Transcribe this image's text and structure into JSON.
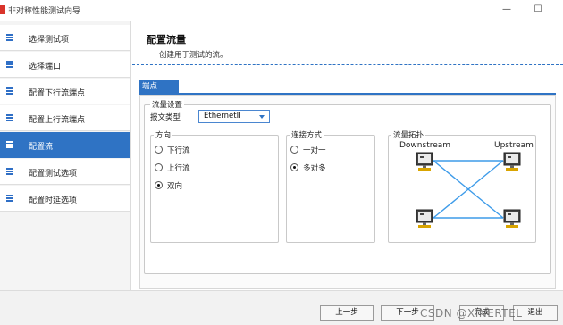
{
  "window": {
    "title": "非对称性能测试向导",
    "minimize_glyph": "—",
    "maximize_glyph": "☐"
  },
  "sidebar": {
    "items": [
      {
        "label": "选择测试项",
        "active": false
      },
      {
        "label": "选择端口",
        "active": false
      },
      {
        "label": "配置下行流端点",
        "active": false
      },
      {
        "label": "配置上行流端点",
        "active": false
      },
      {
        "label": "配置流",
        "active": true
      },
      {
        "label": "配置测试选项",
        "active": false
      },
      {
        "label": "配置时延选项",
        "active": false
      }
    ]
  },
  "main": {
    "title": "配置流量",
    "subtitle": "创建用于测试的流。",
    "tab_label": "端点",
    "flow_settings": {
      "legend": "流量设置",
      "frame_type_label": "报文类型",
      "frame_type_value": "EthernetII"
    },
    "direction": {
      "legend": "方向",
      "options": [
        {
          "label": "下行流",
          "checked": false
        },
        {
          "label": "上行流",
          "checked": false
        },
        {
          "label": "双向",
          "checked": true
        }
      ]
    },
    "connection": {
      "legend": "连接方式",
      "options": [
        {
          "label": "一对一",
          "checked": false
        },
        {
          "label": "多对多",
          "checked": true
        }
      ]
    },
    "topology": {
      "legend": "流量拓扑",
      "downstream_label": "Downstream",
      "upstream_label": "Upstream"
    }
  },
  "footer": {
    "prev_label": "上一步",
    "next_label": "下一步",
    "finish_label": "完成",
    "exit_label": "退出"
  },
  "watermark": "CSDN @XINERTEL",
  "colors": {
    "accent": "#2f73c4",
    "topology_line": "#3d9be9",
    "close_red": "#d9342b"
  }
}
